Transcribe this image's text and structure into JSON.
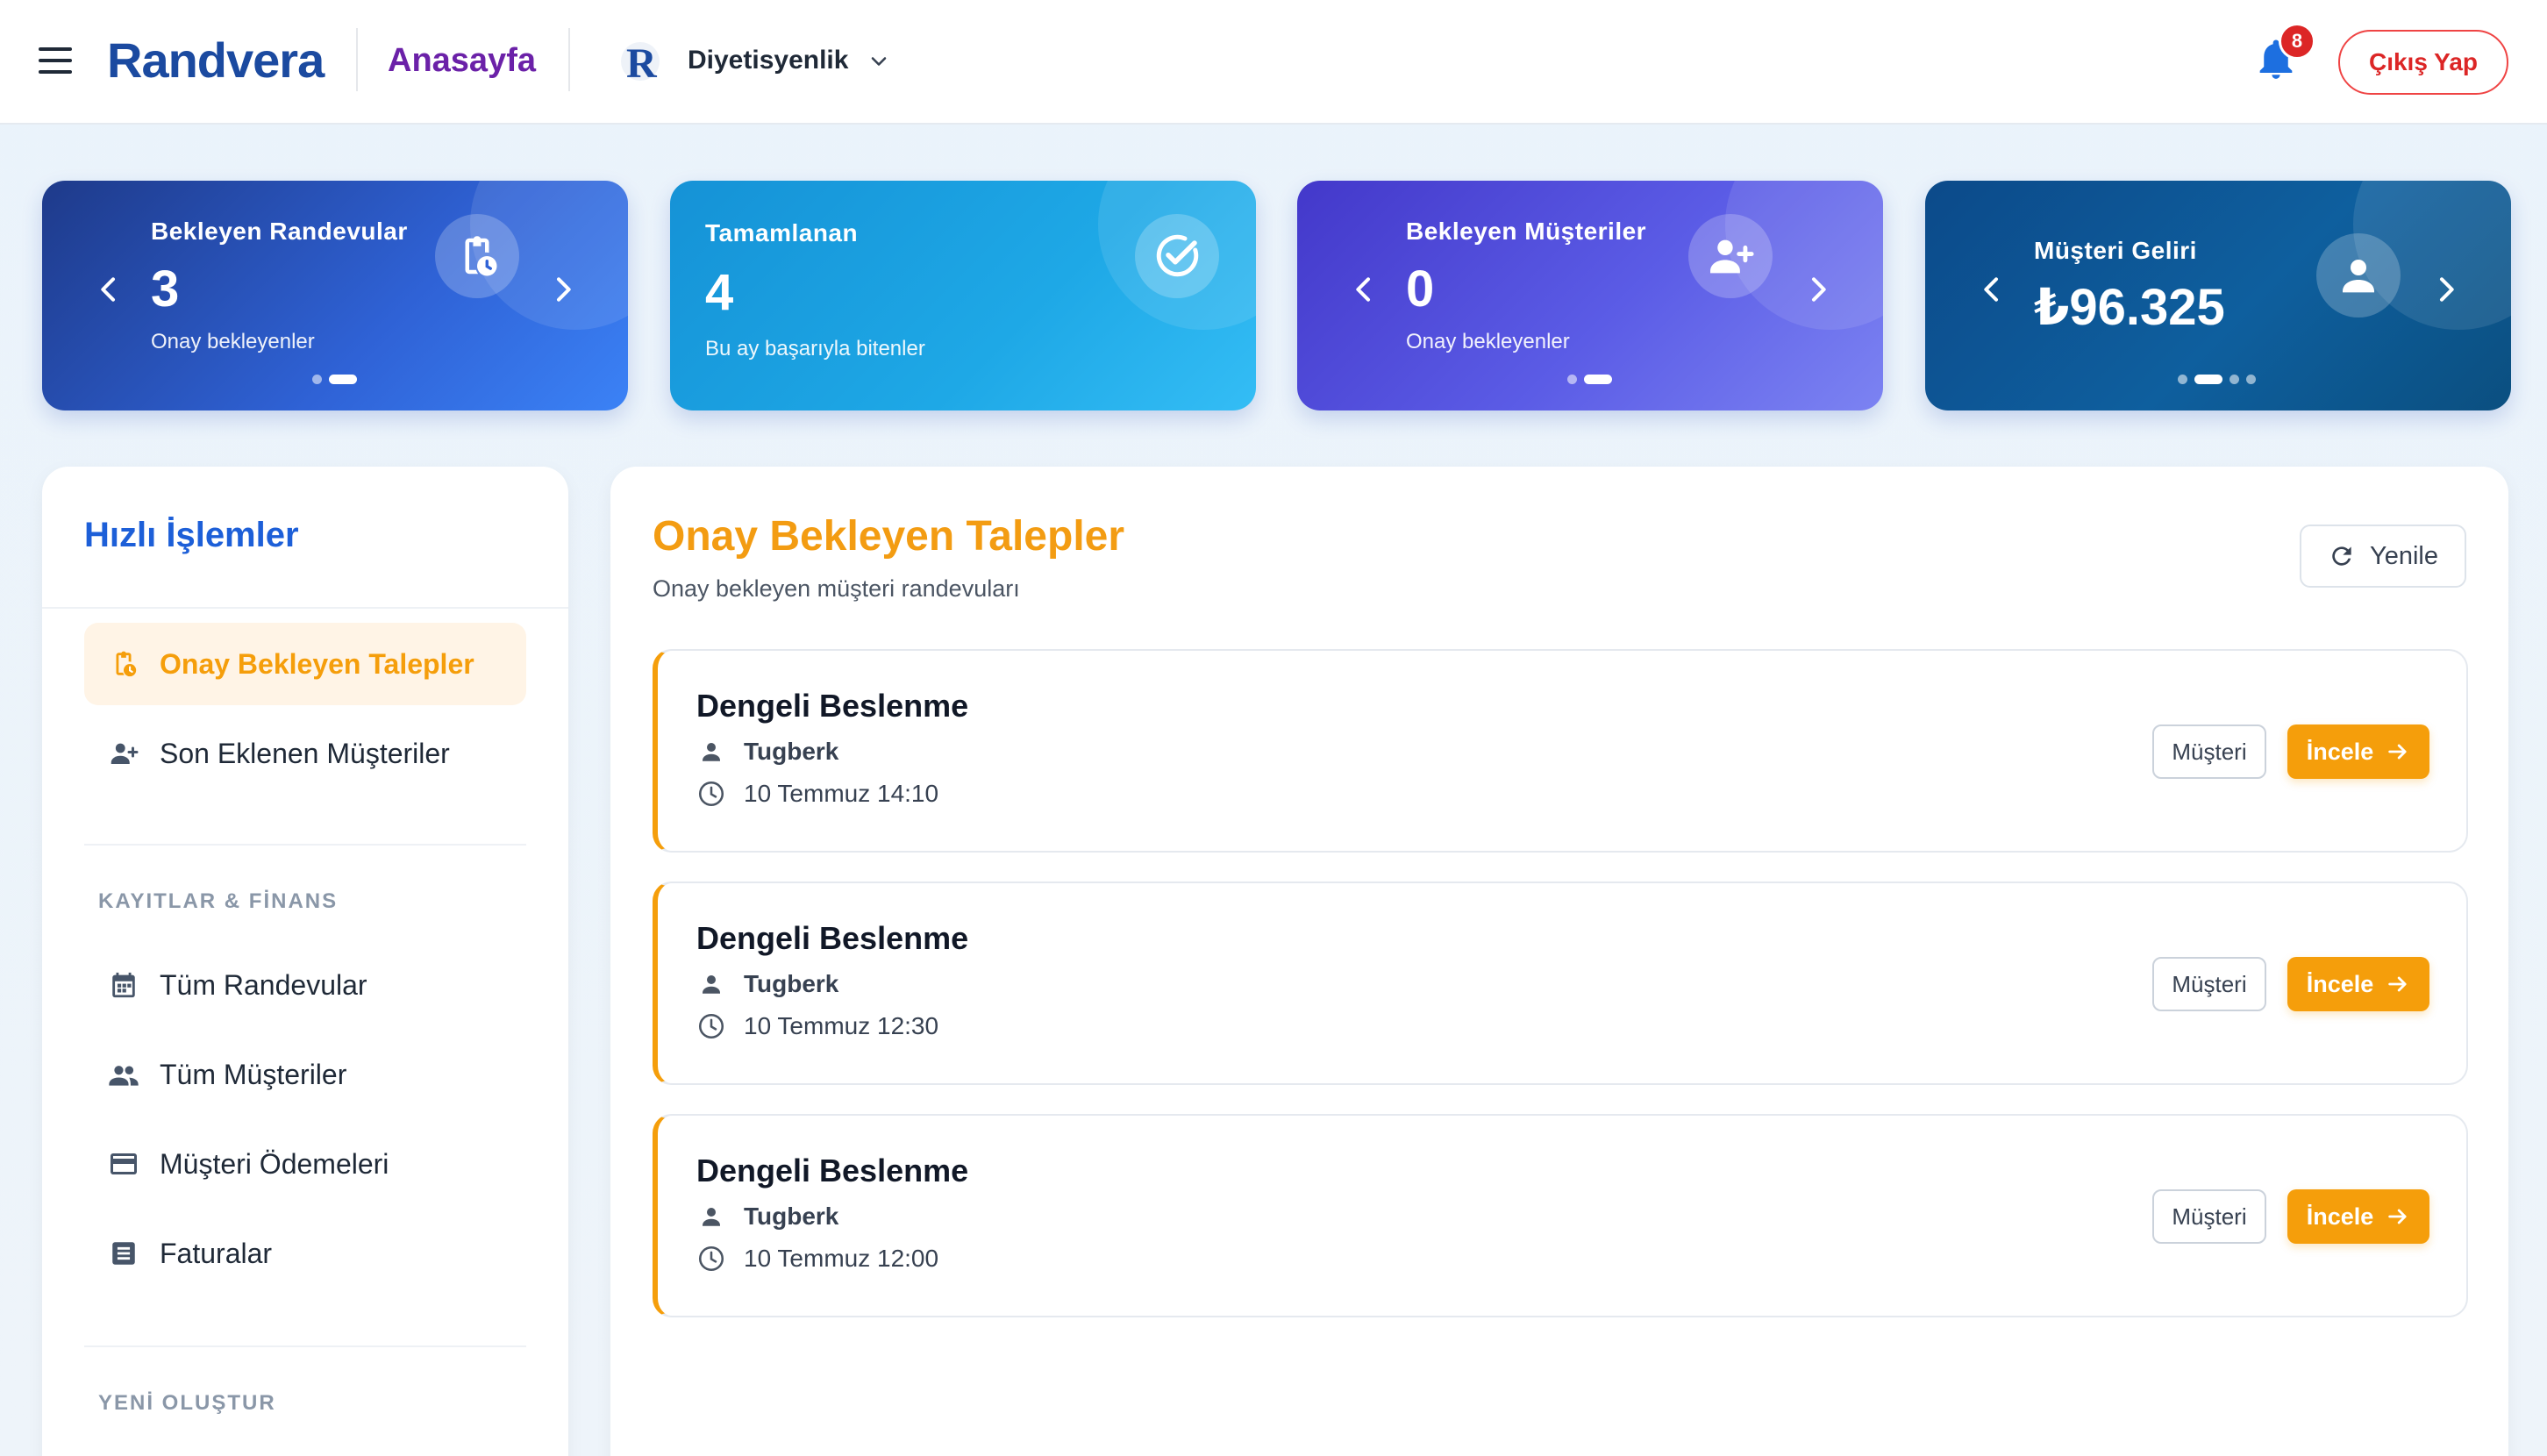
{
  "header": {
    "brand": "Randvera",
    "nav_home": "Anasayfa",
    "business_logo_letter": "R",
    "business_name": "Diyetisyenlik",
    "notification_count": "8",
    "logout_label": "Çıkış Yap"
  },
  "stats": [
    {
      "label": "Bekleyen Randevular",
      "value": "3",
      "sub": "Onay bekleyenler",
      "icon": "clipboard-clock-icon",
      "dots": 2,
      "active_dot": 2
    },
    {
      "label": "Tamamlanan",
      "value": "4",
      "sub": "Bu ay başarıyla bitenler",
      "icon": "check-circle-icon"
    },
    {
      "label": "Bekleyen Müşteriler",
      "value": "0",
      "sub": "Onay bekleyenler",
      "icon": "person-add-icon",
      "dots": 2,
      "active_dot": 2
    },
    {
      "label": "Müşteri Geliri",
      "value": "₺96.325",
      "sub": "",
      "icon": "person-icon",
      "dots": 4,
      "active_dot": 2
    }
  ],
  "sidebar": {
    "title": "Hızlı İşlemler",
    "quick_items": [
      {
        "label": "Onay Bekleyen Talepler",
        "icon": "clipboard-clock-icon",
        "active": true
      },
      {
        "label": "Son Eklenen Müşteriler",
        "icon": "person-add-icon",
        "active": false
      }
    ],
    "section_records": "KAYITLAR & FİNANS",
    "record_items": [
      {
        "label": "Tüm Randevular",
        "icon": "calendar-icon"
      },
      {
        "label": "Tüm Müşteriler",
        "icon": "people-icon"
      },
      {
        "label": "Müşteri Ödemeleri",
        "icon": "credit-card-icon"
      },
      {
        "label": "Faturalar",
        "icon": "receipt-icon"
      }
    ],
    "section_new": "YENİ OLUŞTUR"
  },
  "main": {
    "title": "Onay Bekleyen Talepler",
    "subtitle": "Onay bekleyen müşteri randevuları",
    "refresh_label": "Yenile",
    "customer_button_label": "Müşteri",
    "review_button_label": "İncele",
    "requests": [
      {
        "service": "Dengeli Beslenme",
        "customer": "Tugberk",
        "time": "10 Temmuz 14:10"
      },
      {
        "service": "Dengeli Beslenme",
        "customer": "Tugberk",
        "time": "10 Temmuz 12:30"
      },
      {
        "service": "Dengeli Beslenme",
        "customer": "Tugberk",
        "time": "10 Temmuz 12:00"
      }
    ]
  },
  "colors": {
    "brand": "#1b4aa0",
    "accent_orange": "#f59e0b",
    "nav_purple": "#6b21a8",
    "danger": "#dc2626",
    "sidebar_title": "#1d5fd8"
  }
}
